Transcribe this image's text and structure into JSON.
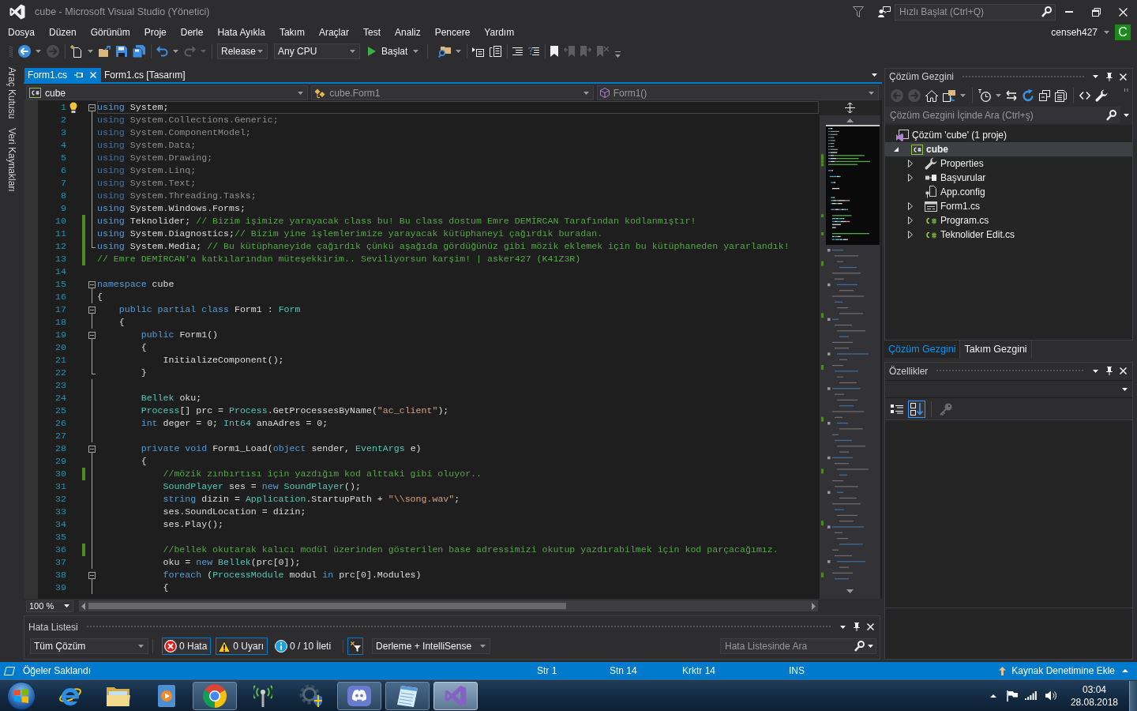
{
  "window": {
    "title": "cube - Microsoft Visual Studio (Yönetici)",
    "quick_launch_placeholder": "Hızlı Başlat (Ctrl+Q)"
  },
  "menu": [
    "Dosya",
    "Düzen",
    "Görünüm",
    "Proje",
    "Derle",
    "Hata Ayıkla",
    "Takım",
    "Araçlar",
    "Test",
    "Analiz",
    "Pencere",
    "Yardım"
  ],
  "account": {
    "name": "censeh427",
    "initial": "C"
  },
  "toolbar": {
    "left_groups": [
      [
        {
          "kind": "back",
          "disabled": false,
          "dropdown": true
        },
        {
          "kind": "forward",
          "disabled": true,
          "dropdown": false
        }
      ],
      [
        {
          "kind": "new",
          "disabled": false,
          "dropdown": true
        },
        {
          "kind": "open",
          "disabled": false,
          "dropdown": false
        },
        {
          "kind": "save",
          "disabled": false,
          "dropdown": false
        },
        {
          "kind": "saveall",
          "disabled": false,
          "dropdown": false
        }
      ],
      [
        {
          "kind": "undo",
          "disabled": false,
          "dropdown": true
        },
        {
          "kind": "redo",
          "disabled": true,
          "dropdown": true
        }
      ]
    ],
    "configuration": "Release",
    "platform": "Any CPU",
    "start": "Başlat",
    "right_groups": [
      [
        {
          "kind": "find",
          "disabled": false,
          "dropdown": true
        }
      ],
      [
        {
          "kind": "arrowbox",
          "disabled": false,
          "dropdown": false
        },
        {
          "kind": "pages",
          "disabled": false,
          "dropdown": false
        }
      ],
      [
        {
          "kind": "comment",
          "disabled": false,
          "dropdown": false
        },
        {
          "kind": "uncomment",
          "disabled": false,
          "dropdown": false
        }
      ],
      [
        {
          "kind": "bookmark",
          "disabled": false,
          "dropdown": false
        },
        {
          "kind": "bookmarkprev",
          "disabled": true,
          "dropdown": false
        },
        {
          "kind": "bookmarknext",
          "disabled": true,
          "dropdown": false
        },
        {
          "kind": "bookmarkclear",
          "disabled": true,
          "dropdown": false
        }
      ]
    ]
  },
  "side_tabs": [
    "Araç Kutusu",
    "Veri Kaynakları"
  ],
  "document_tabs": [
    {
      "label": "Form1.cs",
      "selected": true
    },
    {
      "label": "Form1.cs [Tasarım]",
      "selected": false
    }
  ],
  "navigation_bar": [
    {
      "kind": "project",
      "label": "cube",
      "dimmed": false
    },
    {
      "kind": "class",
      "label": "cube.Form1",
      "dimmed": true
    },
    {
      "kind": "method",
      "label": "Form1()",
      "dimmed": true
    }
  ],
  "editor": {
    "lines": [
      {
        "number": "1",
        "current": true,
        "changed": false,
        "kind": "start",
        "tokens": [
          {
            "kind": "keyword",
            "text": "using"
          },
          {
            "kind": "plain",
            "text": " System;"
          }
        ]
      },
      {
        "number": "2",
        "current": false,
        "changed": false,
        "kind": "body",
        "tokens": [
          {
            "kind": "unusedkeyword",
            "text": "using"
          },
          {
            "kind": "unusedplain",
            "text": " System.Collections.Generic;"
          }
        ]
      },
      {
        "number": "3",
        "current": false,
        "changed": false,
        "kind": "body",
        "tokens": [
          {
            "kind": "unusedkeyword",
            "text": "using"
          },
          {
            "kind": "unusedplain",
            "text": " System.ComponentModel;"
          }
        ]
      },
      {
        "number": "4",
        "current": false,
        "changed": false,
        "kind": "body",
        "tokens": [
          {
            "kind": "unusedkeyword",
            "text": "using"
          },
          {
            "kind": "unusedplain",
            "text": " System.Data;"
          }
        ]
      },
      {
        "number": "5",
        "current": false,
        "changed": false,
        "kind": "body",
        "tokens": [
          {
            "kind": "unusedkeyword",
            "text": "using"
          },
          {
            "kind": "unusedplain",
            "text": " System.Drawing;"
          }
        ]
      },
      {
        "number": "6",
        "current": false,
        "changed": false,
        "kind": "body",
        "tokens": [
          {
            "kind": "unusedkeyword",
            "text": "using"
          },
          {
            "kind": "unusedplain",
            "text": " System.Linq;"
          }
        ]
      },
      {
        "number": "7",
        "current": false,
        "changed": false,
        "kind": "body",
        "tokens": [
          {
            "kind": "unusedkeyword",
            "text": "using"
          },
          {
            "kind": "unusedplain",
            "text": " System.Text;"
          }
        ]
      },
      {
        "number": "8",
        "current": false,
        "changed": false,
        "kind": "body",
        "tokens": [
          {
            "kind": "unusedkeyword",
            "text": "using"
          },
          {
            "kind": "unusedplain",
            "text": " System.Threading.Tasks;"
          }
        ]
      },
      {
        "number": "9",
        "current": false,
        "changed": false,
        "kind": "body",
        "tokens": [
          {
            "kind": "keyword",
            "text": "using"
          },
          {
            "kind": "plain",
            "text": " System.Windows.Forms;"
          }
        ]
      },
      {
        "number": "10",
        "current": false,
        "changed": true,
        "kind": "body",
        "tokens": [
          {
            "kind": "keyword",
            "text": "using"
          },
          {
            "kind": "plain",
            "text": " Teknolider; "
          },
          {
            "kind": "comment",
            "text": "// Bizim işimize yarayacak class bu! Bu class dostum Emre DEMİRCAN Tarafından kodlanmıştır!"
          }
        ]
      },
      {
        "number": "11",
        "current": false,
        "changed": true,
        "kind": "body",
        "tokens": [
          {
            "kind": "keyword",
            "text": "using"
          },
          {
            "kind": "plain",
            "text": " System.Diagnostics;"
          },
          {
            "kind": "comment",
            "text": "// Bizim yine işlemlerimize yarayacak kütüphaneyi çağırdık buradan."
          }
        ]
      },
      {
        "number": "12",
        "current": false,
        "changed": true,
        "kind": "end",
        "tokens": [
          {
            "kind": "keyword",
            "text": "using"
          },
          {
            "kind": "plain",
            "text": " System.Media; "
          },
          {
            "kind": "comment",
            "text": "// Bu kütüphaneyide çağırdık çünkü aşağıda gördüğünüz gibi mözik eklemek için bu kütüphaneden yararlandık!"
          }
        ]
      },
      {
        "number": "13",
        "current": false,
        "changed": true,
        "kind": "flat",
        "tokens": [
          {
            "kind": "comment",
            "text": "// Emre DEMİRCAN'a katkılarından müteşekkirim.. Seviliyorsun karşim! | asker427 (K41Z3R)"
          }
        ]
      },
      {
        "number": "14",
        "current": false,
        "changed": false,
        "kind": "flat"
      },
      {
        "number": "15",
        "current": false,
        "changed": false,
        "kind": "start",
        "tokens": [
          {
            "kind": "keyword",
            "text": "namespace"
          },
          {
            "kind": "plain",
            "text": " cube"
          }
        ]
      },
      {
        "number": "16",
        "current": false,
        "changed": false,
        "kind": "body",
        "tokens": [
          {
            "kind": "plain",
            "text": "{"
          }
        ]
      },
      {
        "number": "17",
        "current": false,
        "changed": false,
        "kind": "start",
        "tokens": [
          {
            "kind": "keyword",
            "text": "    public partial class"
          },
          {
            "kind": "plain",
            "text": " Form1 : "
          },
          {
            "kind": "type",
            "text": "Form"
          }
        ]
      },
      {
        "number": "18",
        "current": false,
        "changed": false,
        "kind": "body",
        "tokens": [
          {
            "kind": "plain",
            "text": "    {"
          }
        ]
      },
      {
        "number": "19",
        "current": false,
        "changed": false,
        "kind": "start",
        "tokens": [
          {
            "kind": "keyword",
            "text": "        public"
          },
          {
            "kind": "plain",
            "text": " Form1()"
          }
        ]
      },
      {
        "number": "20",
        "current": false,
        "changed": false,
        "kind": "body",
        "tokens": [
          {
            "kind": "plain",
            "text": "        {"
          }
        ]
      },
      {
        "number": "21",
        "current": false,
        "changed": false,
        "kind": "body",
        "tokens": [
          {
            "kind": "plain",
            "text": "            InitializeComponent();"
          }
        ]
      },
      {
        "number": "22",
        "current": false,
        "changed": false,
        "kind": "end",
        "tokens": [
          {
            "kind": "plain",
            "text": "        }"
          }
        ]
      },
      {
        "number": "23",
        "current": false,
        "changed": false,
        "kind": "body"
      },
      {
        "number": "24",
        "current": false,
        "changed": false,
        "kind": "body",
        "tokens": [
          {
            "kind": "type",
            "text": "        Bellek"
          },
          {
            "kind": "plain",
            "text": " oku;"
          }
        ]
      },
      {
        "number": "25",
        "current": false,
        "changed": false,
        "kind": "body",
        "tokens": [
          {
            "kind": "type",
            "text": "        Process"
          },
          {
            "kind": "plain",
            "text": "[] prc = "
          },
          {
            "kind": "type",
            "text": "Process"
          },
          {
            "kind": "plain",
            "text": ".GetProcessesByName("
          },
          {
            "kind": "string",
            "text": "\"ac_client\""
          },
          {
            "kind": "plain",
            "text": ");"
          }
        ]
      },
      {
        "number": "26",
        "current": false,
        "changed": false,
        "kind": "body",
        "tokens": [
          {
            "kind": "keyword",
            "text": "        int"
          },
          {
            "kind": "plain",
            "text": " deger = 0; "
          },
          {
            "kind": "type",
            "text": "Int64"
          },
          {
            "kind": "plain",
            "text": " anaAdres = 0;"
          }
        ]
      },
      {
        "number": "27",
        "current": false,
        "changed": false,
        "kind": "body"
      },
      {
        "number": "28",
        "current": false,
        "changed": false,
        "kind": "start",
        "tokens": [
          {
            "kind": "keyword",
            "text": "        private void"
          },
          {
            "kind": "plain",
            "text": " Form1_Load("
          },
          {
            "kind": "keyword",
            "text": "object"
          },
          {
            "kind": "plain",
            "text": " sender, "
          },
          {
            "kind": "type",
            "text": "EventArgs"
          },
          {
            "kind": "plain",
            "text": " e)"
          }
        ]
      },
      {
        "number": "29",
        "current": false,
        "changed": false,
        "kind": "body",
        "tokens": [
          {
            "kind": "plain",
            "text": "        {"
          }
        ]
      },
      {
        "number": "30",
        "current": false,
        "changed": true,
        "kind": "body",
        "tokens": [
          {
            "kind": "comment",
            "text": "            //mözik zınbırtısı için yazdığım kod alttaki gibi oluyor.."
          }
        ]
      },
      {
        "number": "31",
        "current": false,
        "changed": false,
        "kind": "body",
        "tokens": [
          {
            "kind": "type",
            "text": "            SoundPlayer"
          },
          {
            "kind": "plain",
            "text": " ses = "
          },
          {
            "kind": "keyword",
            "text": "new"
          },
          {
            "kind": "type",
            "text": " SoundPlayer"
          },
          {
            "kind": "plain",
            "text": "();"
          }
        ]
      },
      {
        "number": "32",
        "current": false,
        "changed": false,
        "kind": "body",
        "tokens": [
          {
            "kind": "keyword",
            "text": "            string"
          },
          {
            "kind": "plain",
            "text": " dizin = "
          },
          {
            "kind": "type",
            "text": "Application"
          },
          {
            "kind": "plain",
            "text": ".StartupPath + "
          },
          {
            "kind": "string",
            "text": "\"\\\\song.wav\""
          },
          {
            "kind": "plain",
            "text": ";"
          }
        ]
      },
      {
        "number": "33",
        "current": false,
        "changed": false,
        "kind": "body",
        "tokens": [
          {
            "kind": "plain",
            "text": "            ses.SoundLocation = dizin;"
          }
        ]
      },
      {
        "number": "34",
        "current": false,
        "changed": false,
        "kind": "body",
        "tokens": [
          {
            "kind": "plain",
            "text": "            ses.Play();"
          }
        ]
      },
      {
        "number": "35",
        "current": false,
        "changed": false,
        "kind": "body"
      },
      {
        "number": "36",
        "current": false,
        "changed": true,
        "kind": "body",
        "tokens": [
          {
            "kind": "comment",
            "text": "            //bellek okutarak kalıcı modül üzerinden gösterilen base adressimizi okutup yazdırabilmek için kod parçacağımız."
          }
        ]
      },
      {
        "number": "37",
        "current": false,
        "changed": false,
        "kind": "body",
        "tokens": [
          {
            "kind": "plain",
            "text": "            oku = "
          },
          {
            "kind": "keyword",
            "text": "new"
          },
          {
            "kind": "type",
            "text": " Bellek"
          },
          {
            "kind": "plain",
            "text": "(prc[0]);"
          }
        ]
      },
      {
        "number": "38",
        "current": false,
        "changed": false,
        "kind": "start",
        "tokens": [
          {
            "kind": "keyword",
            "text": "            foreach"
          },
          {
            "kind": "plain",
            "text": " ("
          },
          {
            "kind": "type",
            "text": "ProcessModule"
          },
          {
            "kind": "plain",
            "text": " modul "
          },
          {
            "kind": "keyword",
            "text": "in"
          },
          {
            "kind": "plain",
            "text": " prc[0].Modules)"
          }
        ]
      },
      {
        "number": "39",
        "current": false,
        "changed": false,
        "kind": "body",
        "tokens": [
          {
            "kind": "plain",
            "text": "            {"
          }
        ]
      }
    ],
    "zoom": "100 %"
  },
  "error_list": {
    "title": "Hata Listesi",
    "scope": "Tüm Çözüm",
    "filters": [
      {
        "kind": "error",
        "label": "0 Hata",
        "selected": true
      },
      {
        "kind": "warning",
        "label": "0 Uyarı",
        "selected": true
      },
      {
        "kind": "info",
        "label": "0 / 10 İleti",
        "selected": false
      }
    ],
    "filter_toggle": {
      "selected": true
    },
    "source": "Derleme + IntelliSense",
    "search_placeholder": "Hata Listesinde Ara"
  },
  "solution_explorer": {
    "title": "Çözüm Gezgini",
    "groups": [
      [
        {
          "kind": "back",
          "disabled": true,
          "dropdown": false
        },
        {
          "kind": "forward",
          "disabled": true,
          "dropdown": false
        },
        {
          "kind": "home",
          "disabled": false,
          "dropdown": false
        },
        {
          "kind": "switchviews",
          "disabled": false,
          "dropdown": true
        }
      ],
      [
        {
          "kind": "pending",
          "disabled": false,
          "dropdown": true
        },
        {
          "kind": "sync",
          "disabled": false,
          "dropdown": false
        },
        {
          "kind": "refresh",
          "disabled": false,
          "dropdown": false
        },
        {
          "kind": "collapse",
          "disabled": false,
          "dropdown": false
        },
        {
          "kind": "showall",
          "disabled": false,
          "dropdown": false
        }
      ],
      [
        {
          "kind": "viewcode",
          "disabled": false,
          "dropdown": false
        },
        {
          "kind": "properties",
          "disabled": false,
          "dropdown": false
        }
      ]
    ],
    "search_placeholder": "Çözüm Gezgini İçinde Ara (Ctrl+ş)",
    "tree": [
      {
        "kind": "solution",
        "label": "Çözüm 'cube' (1 proje)",
        "selected": false,
        "children": [
          {
            "kind": "project",
            "label": "cube",
            "selected": true,
            "expanded": true,
            "children": [
              {
                "kind": "properties",
                "label": "Properties",
                "selected": false,
                "expanded": false
              },
              {
                "kind": "references",
                "label": "Başvurular",
                "selected": false,
                "expanded": false
              },
              {
                "kind": "config",
                "label": "App.config",
                "selected": false
              },
              {
                "kind": "form",
                "label": "Form1.cs",
                "selected": false,
                "expanded": false
              },
              {
                "kind": "csharp",
                "label": "Program.cs",
                "selected": false,
                "expanded": false
              },
              {
                "kind": "csharp",
                "label": "Teknolider Edit.cs",
                "selected": false,
                "expanded": false
              }
            ]
          }
        ]
      }
    ],
    "tabs": [
      {
        "label": "Çözüm Gezgini",
        "selected": true
      },
      {
        "label": "Takım Gezgini",
        "selected": false
      }
    ]
  },
  "properties": {
    "title": "Özellikler",
    "views": [
      {
        "kind": "categorized",
        "selected": false,
        "disabled": false
      },
      {
        "kind": "alphabetical",
        "selected": true,
        "disabled": false
      },
      {
        "kind": "pages",
        "selected": false,
        "disabled": true
      }
    ]
  },
  "status_bar": {
    "message": "Öğeler Saklandı",
    "line": "Str 1",
    "column": "Stn 14",
    "character": "Krktr 14",
    "mode": "INS",
    "source_control": "Kaynak Denetimine Ekle"
  },
  "taskbar": {
    "apps": [
      {
        "kind": "ie",
        "open": false,
        "selected": false
      },
      {
        "kind": "folder",
        "open": false,
        "selected": false
      },
      {
        "kind": "player",
        "open": false,
        "selected": false
      },
      {
        "kind": "chrome",
        "open": true,
        "selected": false
      },
      {
        "kind": "antenna",
        "open": false,
        "selected": false
      },
      {
        "kind": "gear",
        "open": false,
        "selected": false
      },
      {
        "kind": "discord",
        "open": true,
        "selected": false
      },
      {
        "kind": "notepad",
        "open": true,
        "selected": false
      },
      {
        "kind": "studio",
        "open": true,
        "selected": true
      }
    ],
    "time": "03:04",
    "date": "28.08.2018"
  }
}
